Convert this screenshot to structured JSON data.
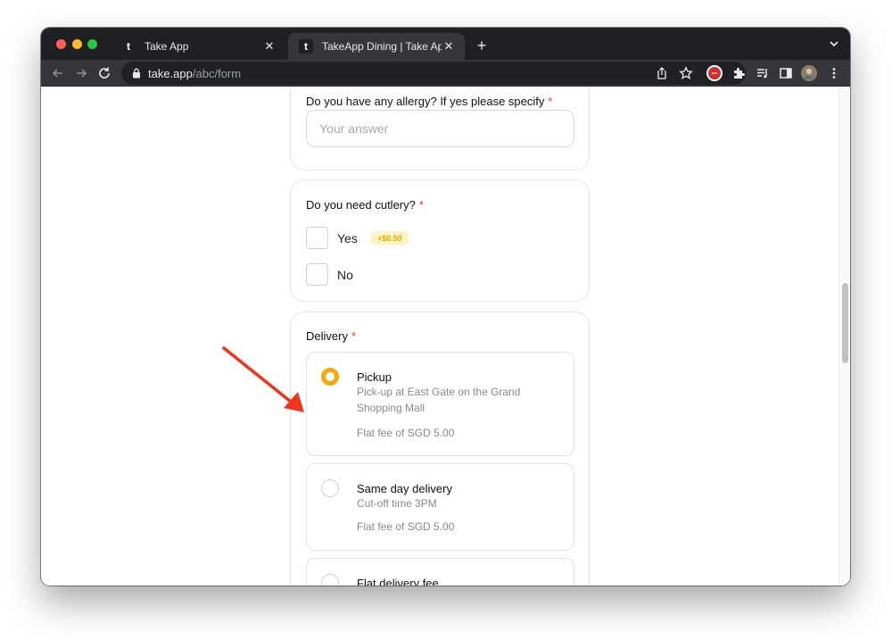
{
  "browser": {
    "tabs": [
      {
        "favicon": "t",
        "title": "Take App"
      },
      {
        "favicon": "t",
        "title": "TakeApp Dining | Take App",
        "active": true
      }
    ],
    "url_host": "take.app",
    "url_path": "/abc/form"
  },
  "form": {
    "allergy": {
      "label": "Do you have any allergy? If yes please specify",
      "required_mark": "*",
      "placeholder": "Your answer"
    },
    "cutlery": {
      "label": "Do you need cutlery?",
      "required_mark": "*",
      "options": [
        {
          "label": "Yes",
          "badge": "+$0.50"
        },
        {
          "label": "No"
        }
      ]
    },
    "delivery": {
      "label": "Delivery",
      "required_mark": "*",
      "options": [
        {
          "title": "Pickup",
          "description": "Pick-up at East Gate on the Grand Shopping Mall",
          "fee": "Flat fee of SGD 5.00",
          "selected": true
        },
        {
          "title": "Same day delivery",
          "description": "Cut-off time 3PM",
          "fee": "Flat fee of SGD 5.00",
          "selected": false
        },
        {
          "title": "Flat delivery fee",
          "selected": false
        }
      ]
    }
  },
  "colors": {
    "accent": "#f6a90a",
    "required": "#e53935",
    "annotation_arrow": "#f0341d"
  }
}
